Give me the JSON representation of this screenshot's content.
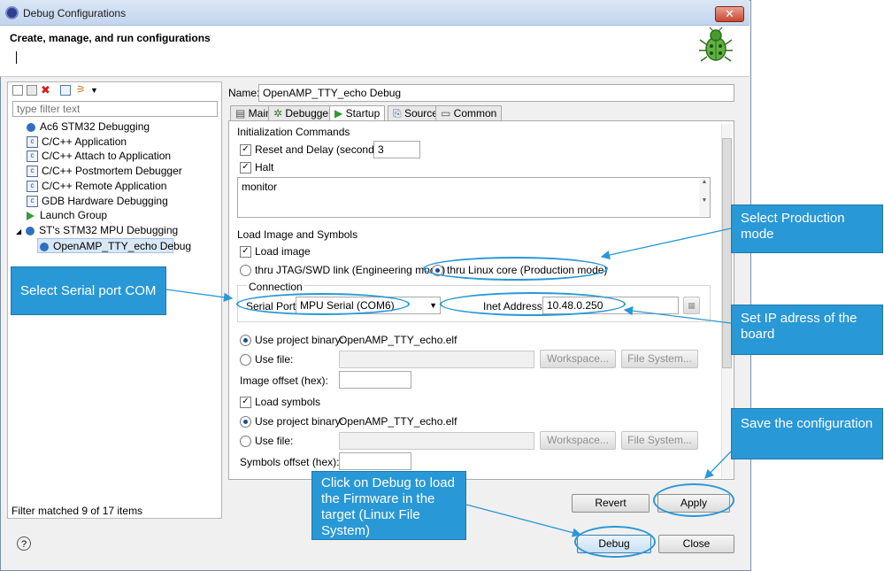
{
  "window": {
    "title": "Debug Configurations",
    "close_glyph": "✕",
    "header_title": "Create, manage, and run configurations"
  },
  "left": {
    "filter_placeholder": "type filter text",
    "items": [
      {
        "label": "Ac6 STM32 Debugging",
        "icon": "debug-icon"
      },
      {
        "label": "C/C++ Application",
        "icon": "c-icon"
      },
      {
        "label": "C/C++ Attach to Application",
        "icon": "c-icon"
      },
      {
        "label": "C/C++ Postmortem Debugger",
        "icon": "c-icon"
      },
      {
        "label": "C/C++ Remote Application",
        "icon": "c-icon"
      },
      {
        "label": "GDB Hardware Debugging",
        "icon": "c-icon"
      },
      {
        "label": "Launch Group",
        "icon": "launch-icon"
      },
      {
        "label": "ST's STM32 MPU Debugging",
        "icon": "debug-icon"
      },
      {
        "label": "OpenAMP_TTY_echo Debug",
        "icon": "debug-icon"
      }
    ],
    "status": "Filter matched 9 of 17 items"
  },
  "right": {
    "name_label": "Name:",
    "name_value": "OpenAMP_TTY_echo Debug",
    "tabs": [
      "Main",
      "Debugger",
      "Startup",
      "Source",
      "Common"
    ],
    "active_tab": "Startup",
    "init_title": "Initialization Commands",
    "reset_label": "Reset and Delay (seconds):",
    "reset_value": "3",
    "halt_label": "Halt",
    "commands_text": "monitor",
    "load_title": "Load Image and Symbols",
    "load_image_label": "Load image",
    "jtag_label": "thru JTAG/SWD link (Engineering mode)",
    "linux_label": "thru Linux core (Production mode)",
    "connection_title": "Connection",
    "serial_label": "Serial Port:",
    "serial_value": "MPU Serial (COM6)",
    "inet_label": "Inet Address:",
    "inet_value": "10.48.0.250",
    "use_project_binary_label": "Use project binary:",
    "binary_value": "OpenAMP_TTY_echo.elf",
    "use_file_label": "Use file:",
    "workspace_label": "Workspace...",
    "filesystem_label": "File System...",
    "image_offset_label": "Image offset (hex):",
    "load_symbols_label": "Load symbols",
    "symbols_offset_label": "Symbols offset (hex):"
  },
  "buttons": {
    "revert": "Revert",
    "apply": "Apply",
    "debug": "Debug",
    "close": "Close",
    "help": "?"
  },
  "callouts": {
    "production": "Select Production mode",
    "serial": "Select Serial port COM",
    "ip": "Set IP adress of the board",
    "save": "Save the configuration",
    "debug": "Click on Debug to load the Firmware in the target (Linux File System)"
  },
  "colors": {
    "callout": "#2998d6",
    "titlebar": "#c2d5ee",
    "close": "#c7462f"
  }
}
